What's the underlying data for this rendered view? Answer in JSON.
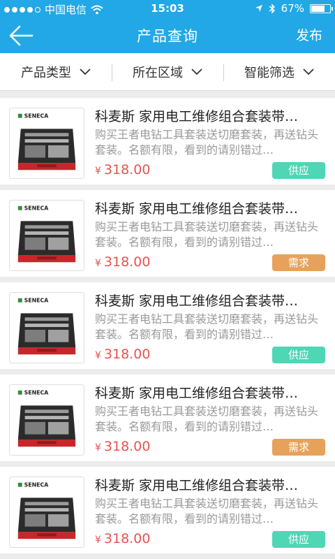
{
  "status_bar": {
    "carrier": "中国电信",
    "time": "15:03",
    "battery": "67%"
  },
  "nav": {
    "title": "产品查询",
    "action": "发布"
  },
  "filters": [
    {
      "label": "产品类型"
    },
    {
      "label": "所在区域"
    },
    {
      "label": "智能筛选"
    }
  ],
  "items": [
    {
      "title": "科麦斯 家用电工维修组合套装带…",
      "desc": "购买王者电钻工具套装送切磨套装，再送钻头套装。名额有限，看到的请别错过…",
      "currency": "¥",
      "price": "318.00",
      "tag": "供应",
      "tag_color": "#4fd6b4"
    },
    {
      "title": "科麦斯 家用电工维修组合套装带…",
      "desc": "购买王者电钻工具套装送切磨套装，再送钻头套装。名额有限，看到的请别错过…",
      "currency": "¥",
      "price": "318.00",
      "tag": "需求",
      "tag_color": "#e6a25a"
    },
    {
      "title": "科麦斯 家用电工维修组合套装带…",
      "desc": "购买王者电钻工具套装送切磨套装，再送钻头套装。名额有限，看到的请别错过…",
      "currency": "¥",
      "price": "318.00",
      "tag": "供应",
      "tag_color": "#4fd6b4"
    },
    {
      "title": "科麦斯 家用电工维修组合套装带…",
      "desc": "购买王者电钻工具套装送切磨套装，再送钻头套装。名额有限，看到的请别错过…",
      "currency": "¥",
      "price": "318.00",
      "tag": "需求",
      "tag_color": "#e6a25a"
    },
    {
      "title": "科麦斯 家用电工维修组合套装带…",
      "desc": "购买王者电钻工具套装送切磨套装，再送钻头套装。名额有限，看到的请别错过…",
      "currency": "¥",
      "price": "318.00",
      "tag": "供应",
      "tag_color": "#4fd6b4"
    }
  ],
  "thumb_brand": "SENECA",
  "colors": {
    "primary": "#22a8e6",
    "price": "#e8534f",
    "supply": "#4fd6b4",
    "demand": "#e6a25a"
  }
}
